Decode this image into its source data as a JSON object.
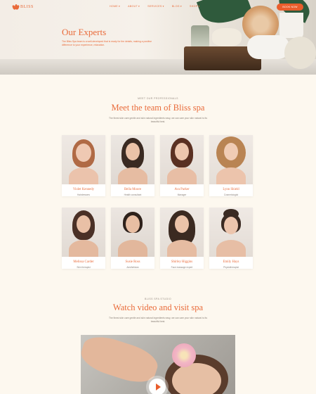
{
  "nav": {
    "logo_text": "BLISS",
    "menu": [
      "HOME",
      "ABOUT",
      "SERVICES",
      "BLOG",
      "SHOP"
    ],
    "chevron": "▾",
    "cta_label": "BOOK NOW"
  },
  "hero": {
    "title": "Our Experts",
    "subtitle": "The Bliss Spa team is a well-developed that is ready for the details, making a positive difference to your experience, relaxation."
  },
  "team": {
    "eyebrow": "MEET OUR PROFESSIONALS",
    "title": "Meet the team of Bliss spa",
    "subtitle": "The finest skin care gentle and skin natural ingredients easy, we can care your skin natural to its beautiful best.",
    "members": [
      {
        "name": "Violet Kennedy",
        "role": "Hairdressers"
      },
      {
        "name": "Bella Moore",
        "role": "Health consultant"
      },
      {
        "name": "Ava Parker",
        "role": "Manager"
      },
      {
        "name": "Lynn Shield",
        "role": "Cosmetologist"
      },
      {
        "name": "Melissa Carder",
        "role": "Skin therapist"
      },
      {
        "name": "Susie Ross",
        "role": "Aesthetician"
      },
      {
        "name": "Shirley Higgins",
        "role": "Face massage expert"
      },
      {
        "name": "Emily Hays",
        "role": "Physiotherapist"
      }
    ]
  },
  "video_section": {
    "eyebrow": "BLISS SPA STUDIO",
    "title": "Watch video and visit spa",
    "subtitle": "The finest skin care gentle and skin natural ingredients easy, we can care your skin natural to its beautiful best."
  },
  "colors": {
    "accent": "#e96b3a",
    "button": "#e95d2c",
    "background": "#fdf8ef"
  }
}
